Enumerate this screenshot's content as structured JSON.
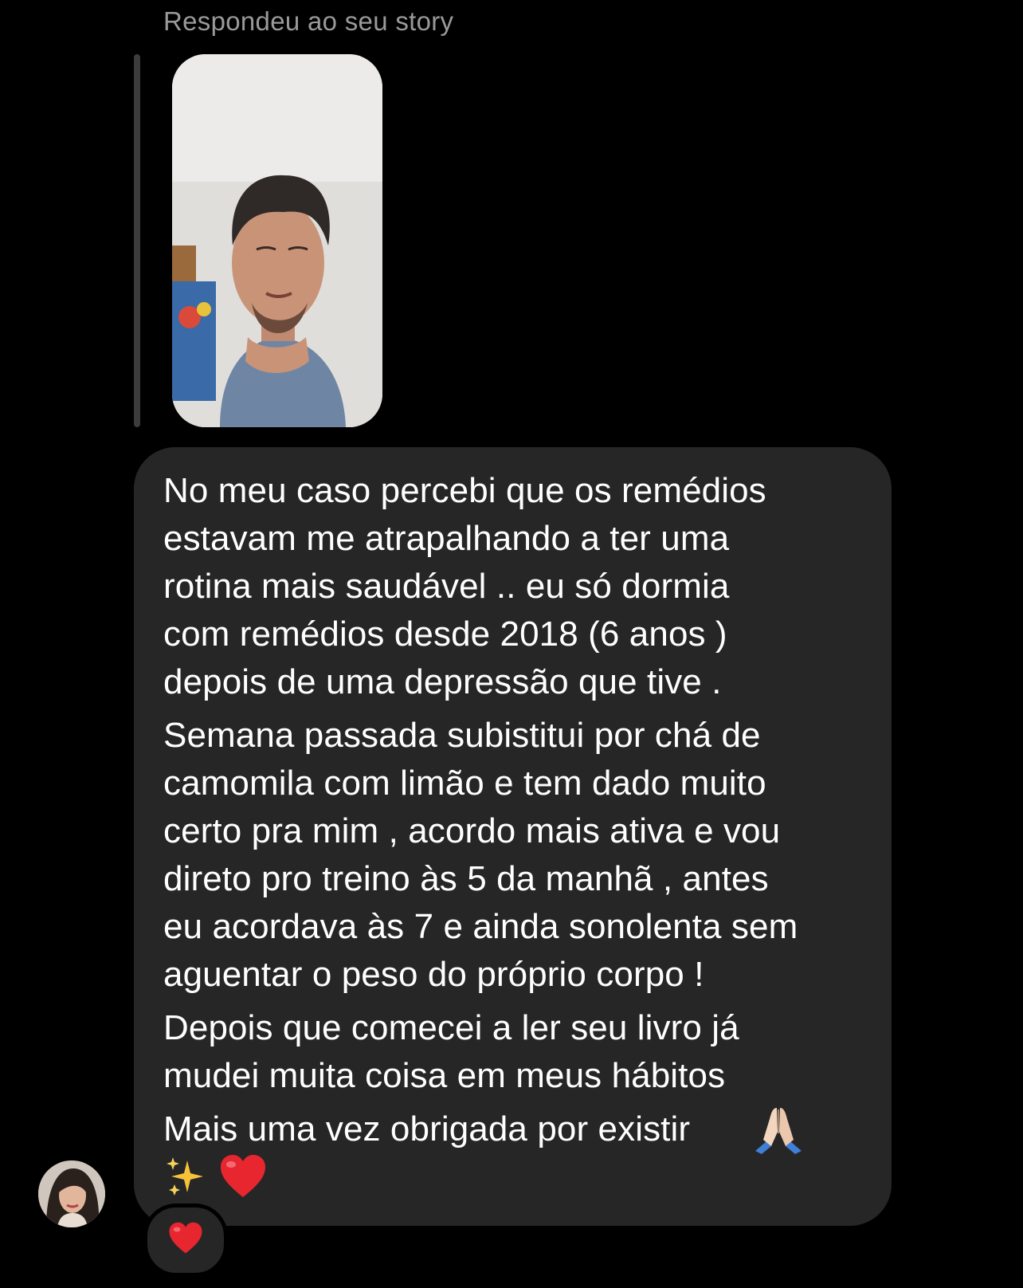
{
  "thread": {
    "reply_context_label": "Respondeu ao seu story",
    "story_thumbnail": {
      "description": "story-video-thumbnail",
      "colors": {
        "wall": "#ecebea",
        "shirt": "#6f85a4",
        "skin": "#c99378",
        "hair": "#2f2a27"
      }
    }
  },
  "message": {
    "lines": [
      "No meu caso percebi que os remédios",
      "estavam me atrapalhando a ter uma",
      "rotina mais saudável .. eu só dormia",
      "com remédios desde 2018 (6 anos )",
      "depois de uma depressão que tive .",
      "Semana passada subistitui por chá de",
      "camomila com limão e tem dado muito",
      "certo pra mim , acordo mais ativa e vou",
      "direto pro treino às 5 da manhã , antes",
      "eu acordava às 7 e ainda sonolenta sem",
      "aguentar o peso do próprio corpo !",
      "Depois que comecei a ler seu livro já",
      "mudei muita coisa em meus hábitos",
      "Mais uma vez obrigada por existir"
    ],
    "trailing_emojis": [
      "praying-hands",
      "sparkles",
      "red-heart"
    ],
    "reaction": "red-heart"
  },
  "sender": {
    "avatar": "sender-profile-photo"
  },
  "colors": {
    "background": "#000000",
    "bubble": "#262626",
    "secondary_text": "#9a9a9a",
    "heart": "#e8262f"
  }
}
